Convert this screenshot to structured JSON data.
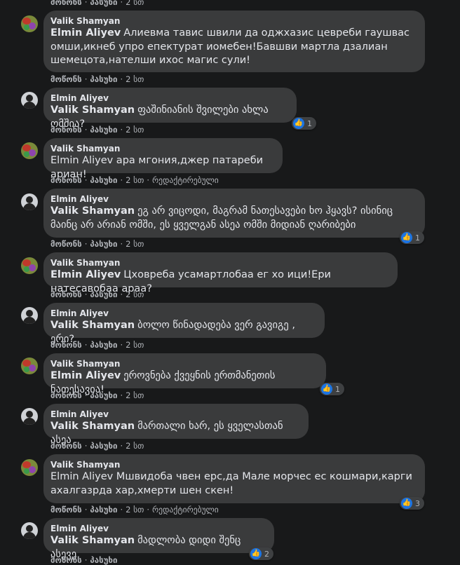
{
  "action_labels": {
    "like": "მოწონს",
    "reply": "პასუხი",
    "edited": "რედაქტირებული"
  },
  "top_actions": {
    "time": "2 სთ"
  },
  "comments": [
    {
      "author": "Valik Shamyan",
      "mention": "Elmin Aliyev",
      "text": "Алиевма тавис швили да оджхазис цевреби гаушвас омши,икнеб упро епектурат иомебен!Бавшви мартла дзалиан шемецота,нателши ихос магис сули!",
      "time": "2 სთ",
      "reactions": "",
      "edited": ""
    },
    {
      "author": "Elmin Aliyev",
      "mention": "Valik Shamyan",
      "text": "ფაშინიანის შვილები ახლა ომშია?",
      "time": "2 სთ",
      "reactions": "1",
      "edited": ""
    },
    {
      "author": "Valik Shamyan",
      "mention": "",
      "text": "Elmin Aliyev ара мгония,джер патареби ариан!",
      "time": "2 სთ",
      "reactions": "",
      "edited": "რედაქტირებული"
    },
    {
      "author": "Elmin Aliyev",
      "mention": "Valik Shamyan",
      "text": "ეგ არ ვიცოდი, მაგრამ ნათესავები ხო ჰყავს? ისინიც მაინც არ არიან ომში, ეს ყველგან ასეა ომში მიდიან ღარიბები",
      "time": "2 სთ",
      "reactions": "1",
      "edited": ""
    },
    {
      "author": "Valik Shamyan",
      "mention": "Elmin Aliyev",
      "text": "Цховреба усамартлобаа ег хо ици!Ери натесавобаа араа?",
      "time": "2 სთ",
      "reactions": "",
      "edited": ""
    },
    {
      "author": "Elmin Aliyev",
      "mention": "Valik Shamyan",
      "text": "ბოლო წინადადება ვერ გავიგე , ერი?",
      "time": "2 სთ",
      "reactions": "",
      "edited": ""
    },
    {
      "author": "Valik Shamyan",
      "mention": "Elmin Aliyev",
      "text": "ეროვნება ქვეყნის ერთმანეთის ნათესავია!",
      "time": "2 სთ",
      "reactions": "1",
      "edited": ""
    },
    {
      "author": "Elmin Aliyev",
      "mention": "Valik Shamyan",
      "text": "მართალი ხარ, ეს ყველასთან ასეა",
      "time": "2 სთ",
      "reactions": "",
      "edited": ""
    },
    {
      "author": "Valik Shamyan",
      "mention": "",
      "text": "Elmin Aliyev Мшвидоба чвен ерс,да Мале морчес ес кошмари,карги ахалгазрда хар,хмерти шен скен!",
      "time": "2 სთ",
      "reactions": "3",
      "edited": "რედაქტირებული"
    },
    {
      "author": "Elmin Aliyev",
      "mention": "Valik Shamyan",
      "text": "მადლობა დიდი შენც ასევე",
      "time": "",
      "reactions": "2",
      "edited": ""
    }
  ]
}
